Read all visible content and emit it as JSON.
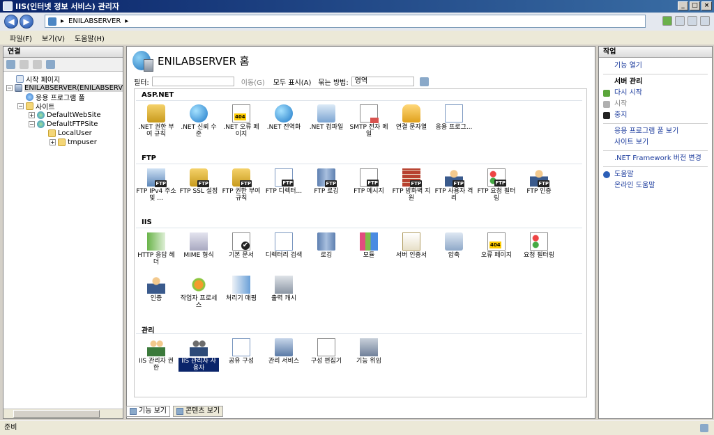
{
  "window": {
    "title": "IIS(인터넷 정보 서비스) 관리자"
  },
  "nav": {
    "address_segments": [
      "▸",
      "ENILABSERVER",
      "▸"
    ]
  },
  "menu": {
    "items": [
      "파일(F)",
      "보기(V)",
      "도움말(H)"
    ]
  },
  "connections": {
    "header": "연결",
    "tree": [
      {
        "label": "시작 페이지",
        "icon": "start-page-icon"
      },
      {
        "label": "ENILABSERVER(ENILABSERV",
        "icon": "server-icon"
      },
      {
        "label": "응용 프로그램 풀",
        "icon": "app-pool-icon"
      },
      {
        "label": "사이트",
        "icon": "sites-folder-icon"
      },
      {
        "label": "DefaultWebSite",
        "icon": "globe-icon"
      },
      {
        "label": "DefaultFTPSite",
        "icon": "globe-icon"
      },
      {
        "label": "LocalUser",
        "icon": "folder-icon"
      },
      {
        "label": "tmpuser",
        "icon": "folder-icon"
      }
    ]
  },
  "center": {
    "title": "ENILABSERVER 홈",
    "filter": {
      "label": "필터:",
      "go": "이동(G)",
      "show_all": "모두 표시(A)",
      "group_label": "묶는 방법:",
      "group_value": "영역"
    },
    "sections": [
      {
        "name": "ASP.NET",
        "items": [
          {
            "label": ".NET 권한 부여 규칙",
            "icon": "lock-icon"
          },
          {
            "label": ".NET 신뢰 수준",
            "icon": "globe-check-icon"
          },
          {
            "label": ".NET 오류 페이지",
            "icon": "error-page-icon"
          },
          {
            "label": ".NET 전역화",
            "icon": "globe-icon"
          },
          {
            "label": ".NET 컴파일",
            "icon": "compile-icon"
          },
          {
            "label": "SMTP 전자 메일",
            "icon": "smtp-icon"
          },
          {
            "label": "연결 문자열",
            "icon": "database-icon"
          },
          {
            "label": "응용 프로그...",
            "icon": "app-settings-icon"
          }
        ]
      },
      {
        "name": "FTP",
        "items": [
          {
            "label": "FTP IPv4 주소 및 ...",
            "icon": "ftp-ip-icon"
          },
          {
            "label": "FTP SSL 설정",
            "icon": "ftp-ssl-icon"
          },
          {
            "label": "FTP 권한 부여 규칙",
            "icon": "ftp-auth-rules-icon"
          },
          {
            "label": "FTP 디렉터...",
            "icon": "ftp-directory-icon"
          },
          {
            "label": "FTP 로깅",
            "icon": "ftp-logging-icon"
          },
          {
            "label": "FTP 메시지",
            "icon": "ftp-messages-icon"
          },
          {
            "label": "FTP 방화벽 지원",
            "icon": "ftp-firewall-icon"
          },
          {
            "label": "FTP 사용자 격리",
            "icon": "ftp-user-isolation-icon"
          },
          {
            "label": "FTP 요청 필터링",
            "icon": "ftp-request-filter-icon"
          },
          {
            "label": "FTP 인증",
            "icon": "ftp-authentication-icon"
          }
        ]
      },
      {
        "name": "IIS",
        "items": [
          {
            "label": "HTTP 응답 헤더",
            "icon": "http-headers-icon"
          },
          {
            "label": "MIME 형식",
            "icon": "mime-icon"
          },
          {
            "label": "기본 문서",
            "icon": "default-doc-icon"
          },
          {
            "label": "디렉터리 검색",
            "icon": "dir-browse-icon"
          },
          {
            "label": "로깅",
            "icon": "logging-icon"
          },
          {
            "label": "모듈",
            "icon": "modules-icon"
          },
          {
            "label": "서버 인증서",
            "icon": "certificate-icon"
          },
          {
            "label": "압축",
            "icon": "compression-icon"
          },
          {
            "label": "오류 페이지",
            "icon": "error-pages-icon"
          },
          {
            "label": "요청 필터링",
            "icon": "request-filter-icon"
          },
          {
            "label": "인증",
            "icon": "authentication-icon"
          },
          {
            "label": "작업자 프로세스",
            "icon": "worker-process-icon"
          },
          {
            "label": "처리기 매핑",
            "icon": "handler-mapping-icon"
          },
          {
            "label": "출력 캐시",
            "icon": "output-cache-icon"
          }
        ]
      },
      {
        "name": "관리",
        "items": [
          {
            "label": "IIS 관리자 권한",
            "icon": "manager-permissions-icon"
          },
          {
            "label": "IIS 관리자 사용자",
            "icon": "manager-users-icon"
          },
          {
            "label": "공유 구성",
            "icon": "shared-config-icon"
          },
          {
            "label": "관리 서비스",
            "icon": "management-service-icon"
          },
          {
            "label": "구성 편집기",
            "icon": "config-editor-icon"
          },
          {
            "label": "기능 위임",
            "icon": "feature-delegation-icon"
          }
        ]
      }
    ],
    "selected_item": "IIS 관리자 사용자",
    "view_tabs": [
      "기능 보기",
      "콘텐츠 보기"
    ]
  },
  "actions": {
    "header": "작업",
    "open_feature": "기능 열기",
    "server_manage": "서버 관리",
    "restart": "다시 시작",
    "start": "시작",
    "stop": "중지",
    "view_pools": "응용 프로그램 풀 보기",
    "view_sites": "사이트 보기",
    "net_version": ".NET Framework 버전 변경",
    "help": "도움말",
    "online_help": "온라인 도움말"
  },
  "status": {
    "text": "준비"
  },
  "colors": {
    "title_bar": "#0a246a",
    "link": "#1a3a9c",
    "selected": "#0a246a"
  }
}
